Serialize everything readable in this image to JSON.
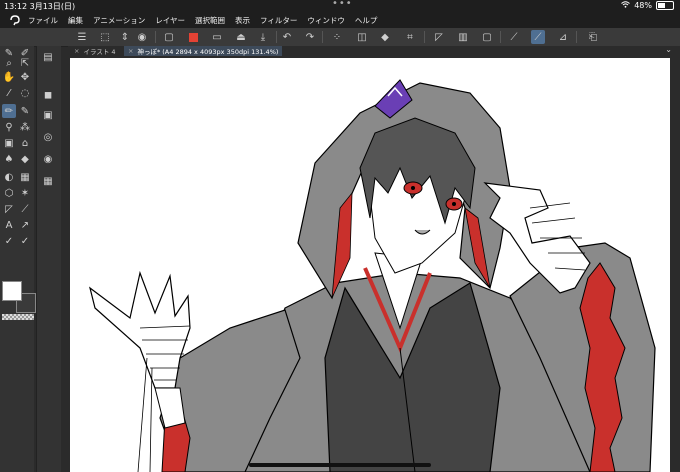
{
  "status": {
    "time": "13:12",
    "date": "3月13日(日)",
    "battery": "48%",
    "battery_level": 0.48
  },
  "menu": [
    "ファイル",
    "編集",
    "アニメーション",
    "レイヤー",
    "選択範囲",
    "表示",
    "フィルター",
    "ウィンドウ",
    "ヘルプ"
  ],
  "tabs": [
    {
      "label": "イラスト 4",
      "active": false
    },
    {
      "label": "神っぽ* (A4 2894 x 4093px 350dpi 131.4%)",
      "active": true
    }
  ],
  "colors": {
    "main_color": "#e34234",
    "accent": "#4f6f92",
    "fill_gray": "#8a8a8a",
    "dark_gray": "#444444",
    "lining_red": "#c9302c"
  }
}
